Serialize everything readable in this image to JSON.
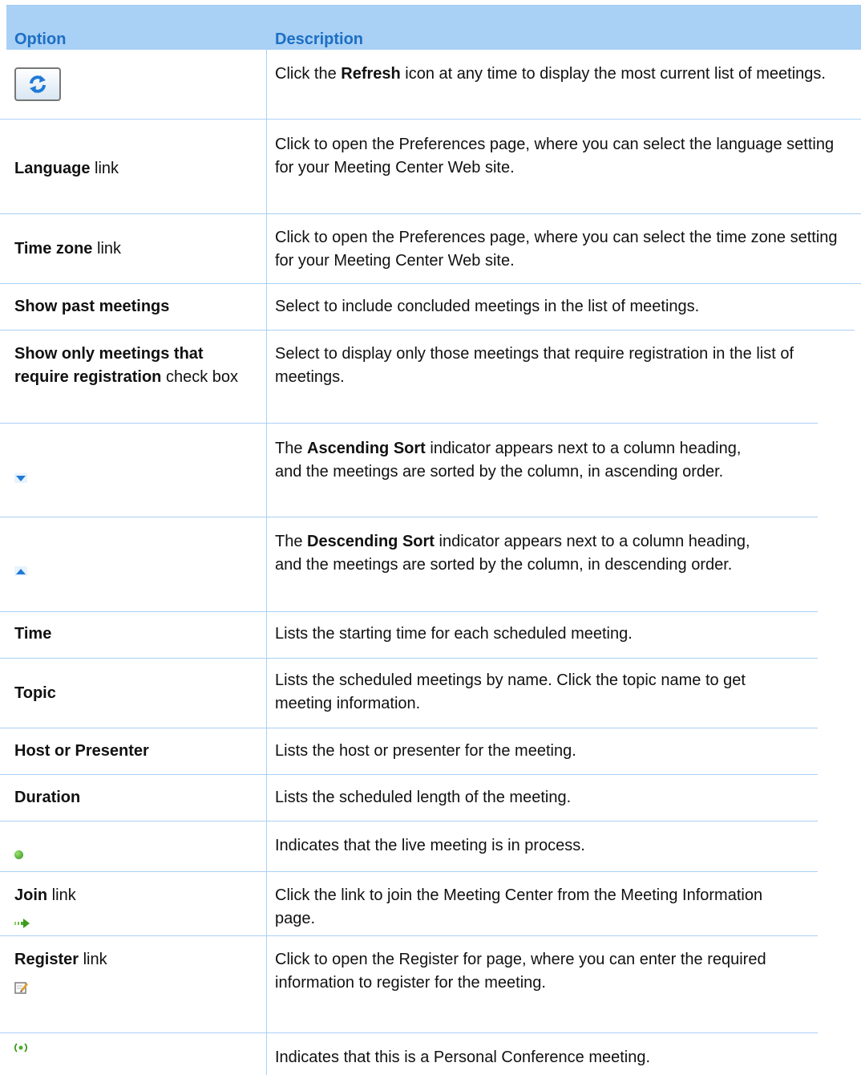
{
  "header": {
    "option": "Option",
    "description": "Description"
  },
  "rows": [
    {
      "option_icon": "refresh-icon",
      "desc_pre": "Click the ",
      "desc_bold": "Refresh",
      "desc_post": " icon at any time to display the most current list of meetings."
    },
    {
      "opt_bold": "Language",
      "opt_post": " link",
      "desc": "Click to open the Preferences page, where you can select the language setting for your Meeting Center Web site."
    },
    {
      "opt_bold": "Time zone",
      "opt_post": " link",
      "desc": "Click to open the Preferences page, where you can select the time zone setting for your Meeting Center Web site."
    },
    {
      "opt_bold": "Show past meetings",
      "desc": "Select to include concluded meetings in the list of meetings."
    },
    {
      "opt_bold": "Show only meetings that require registration",
      "opt_post": " check box",
      "desc": "Select to display only those meetings that require registration in the list of meetings."
    },
    {
      "option_icon": "sort-ascending-icon",
      "desc_pre": "The ",
      "desc_bold": "Ascending Sort",
      "desc_post": " indicator appears next to a column heading, and the meetings are sorted by the column, in ascending order."
    },
    {
      "option_icon": "sort-descending-icon",
      "desc_pre": "The ",
      "desc_bold": "Descending Sort",
      "desc_post": " indicator appears next to a column heading, and the meetings are sorted by the column, in descending order."
    },
    {
      "opt_bold": "Time",
      "desc": "Lists the starting time for each scheduled meeting."
    },
    {
      "opt_bold": "Topic",
      "desc": "Lists the scheduled meetings by name. Click the topic name to get meeting information."
    },
    {
      "opt_bold": "Host or Presenter",
      "desc": "Lists the host or presenter for the meeting."
    },
    {
      "opt_bold": "Duration",
      "desc": "Lists the scheduled length of the meeting."
    },
    {
      "option_icon": "live-meeting-icon",
      "desc": "Indicates that the live meeting is in process."
    },
    {
      "opt_bold": "Join",
      "opt_post": " link",
      "option_icon": "join-arrow-icon",
      "desc": "Click the link to join the Meeting Center from the Meeting Information page."
    },
    {
      "opt_bold": "Register",
      "opt_post": " link",
      "option_icon": "register-edit-icon",
      "desc": "Click to open the Register for page, where you can enter the required information to register for the meeting."
    },
    {
      "option_icon": "personal-conference-icon",
      "desc": "Indicates that this is a Personal Conference meeting."
    }
  ],
  "colors": {
    "header_bg": "#a9d0f5",
    "header_text": "#1c6fc4",
    "rule": "#a9d0f5"
  }
}
